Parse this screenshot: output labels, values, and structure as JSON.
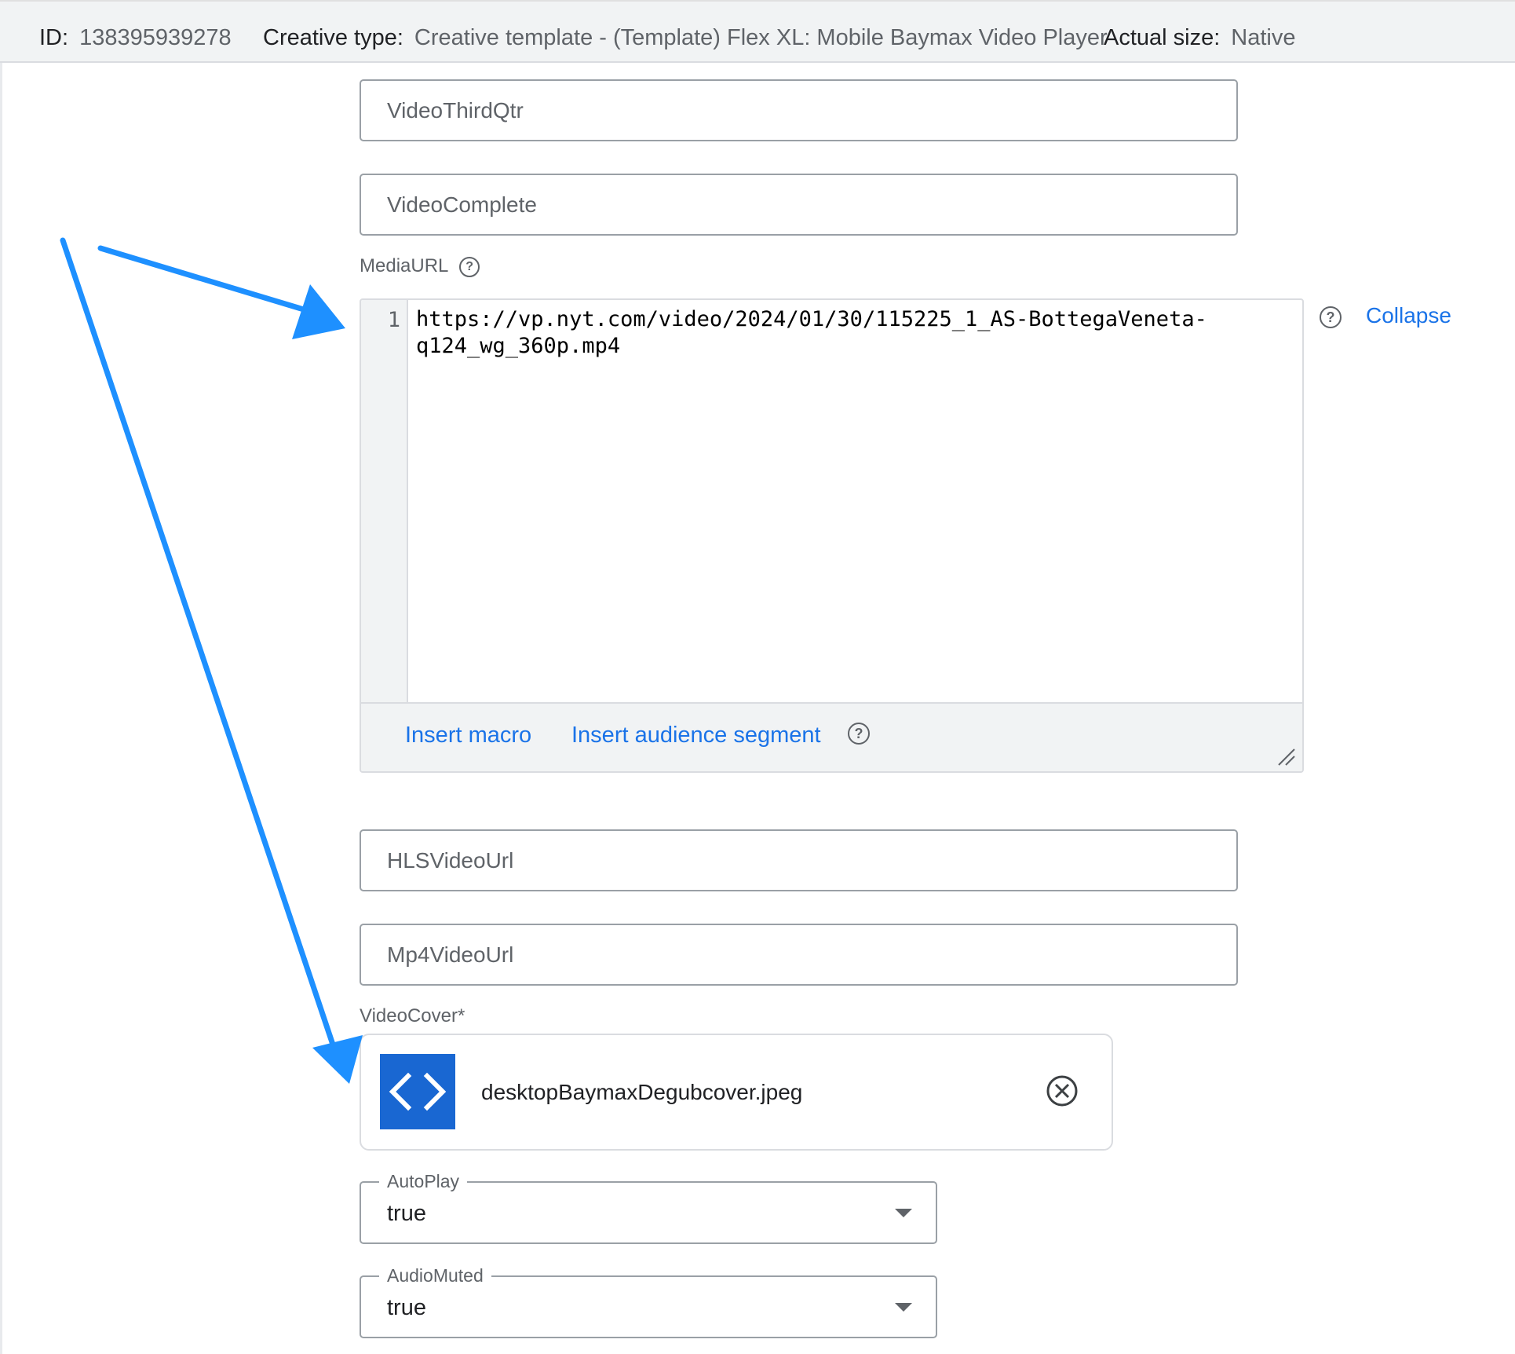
{
  "header": {
    "id_label": "ID:",
    "id_value": "138395939278",
    "type_label": "Creative type:",
    "type_value": "Creative template - (Template) Flex XL: Mobile Baymax Video Player",
    "size_label": "Actual size:",
    "size_value": "Native"
  },
  "fields": {
    "video_third_qtr": {
      "placeholder": "VideoThirdQtr",
      "value": ""
    },
    "video_complete": {
      "placeholder": "VideoComplete",
      "value": ""
    },
    "hls_video_url": {
      "placeholder": "HLSVideoUrl",
      "value": ""
    },
    "mp4_video_url": {
      "placeholder": "Mp4VideoUrl",
      "value": ""
    }
  },
  "media_url": {
    "label": "MediaURL",
    "line_number": "1",
    "code_line_1": "https://vp.nyt.com/video/2024/01/30/115225_1_AS-BottegaVeneta-",
    "code_line_2": "q124_wg_360p.mp4",
    "insert_macro": "Insert macro",
    "insert_audience_segment": "Insert audience segment",
    "collapse": "Collapse"
  },
  "video_cover": {
    "label": "VideoCover*",
    "file_name": "desktopBaymaxDegubcover.jpeg"
  },
  "autoplay": {
    "label": "AutoPlay",
    "value": "true"
  },
  "audio_muted": {
    "label": "AudioMuted",
    "value": "true"
  },
  "icons": {
    "help": "help-circle-icon",
    "file_type": "code-icon",
    "remove": "close-circle-icon",
    "dropdown": "caret-down-icon",
    "resize": "resize-handle-icon"
  },
  "colors": {
    "link": "#1a73e8",
    "header_bg": "#f1f3f4",
    "file_thumb": "#1967d2",
    "annotation_arrow": "#1e90ff"
  }
}
